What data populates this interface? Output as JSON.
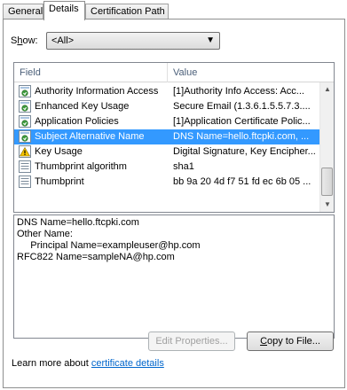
{
  "tabs": [
    {
      "label": "General"
    },
    {
      "label": "Details"
    },
    {
      "label": "Certification Path"
    }
  ],
  "show": {
    "label_prefix": "S",
    "label_accel": "h",
    "label_rest": "ow:",
    "selected": "<All>"
  },
  "list": {
    "headers": {
      "field": "Field",
      "value": "Value"
    },
    "rows": [
      {
        "field": "Authority Information Access",
        "value": "[1]Authority Info Access: Acc...",
        "icon": "cert-extension-icon"
      },
      {
        "field": "Enhanced Key Usage",
        "value": "Secure Email (1.3.6.1.5.5.7.3....",
        "icon": "cert-extension-icon"
      },
      {
        "field": "Application Policies",
        "value": "[1]Application Certificate Polic...",
        "icon": "cert-extension-icon"
      },
      {
        "field": "Subject Alternative Name",
        "value": "DNS Name=hello.ftcpki.com, ...",
        "icon": "cert-extension-icon"
      },
      {
        "field": "Key Usage",
        "value": "Digital Signature, Key Encipher...",
        "icon": "warning-cert-icon"
      },
      {
        "field": "Thumbprint algorithm",
        "value": "sha1",
        "icon": "property-icon"
      },
      {
        "field": "Thumbprint",
        "value": "bb 9a 20 4d f7 51 fd ec 6b 05 ...",
        "icon": "property-icon"
      }
    ],
    "selected_index": 3
  },
  "detail": {
    "lines": [
      "DNS Name=hello.ftcpki.com",
      "Other Name:",
      "     Principal Name=exampleuser@hp.com",
      "RFC822 Name=sampleNA@hp.com"
    ]
  },
  "buttons": {
    "edit": "Edit Properties...",
    "copy_prefix": "",
    "copy_accel": "C",
    "copy_rest": "opy to File..."
  },
  "learn": {
    "text": "Learn more about ",
    "link": "certificate details"
  },
  "colors": {
    "selection": "#3399ff",
    "link": "#0066cc"
  }
}
